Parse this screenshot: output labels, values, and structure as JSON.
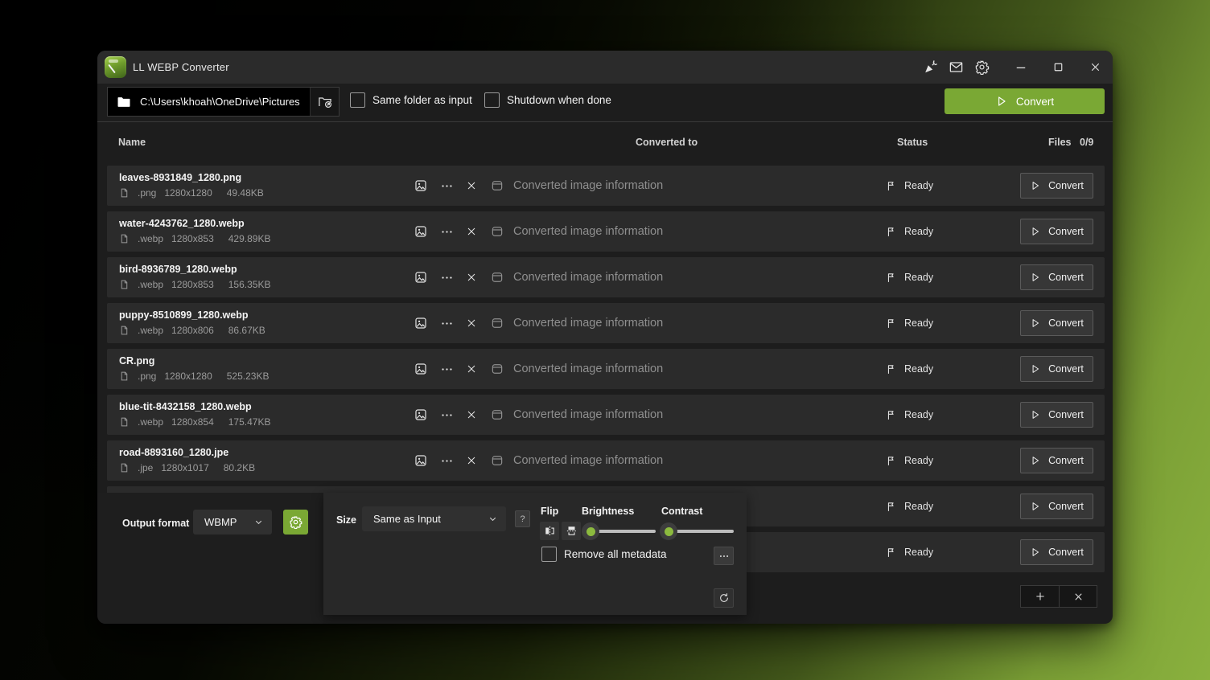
{
  "app": {
    "title": "LL WEBP Converter"
  },
  "toolbar": {
    "path": "C:\\Users\\khoah\\OneDrive\\Pictures",
    "same_folder_label": "Same folder as input",
    "shutdown_label": "Shutdown when done",
    "convert_label": "Convert"
  },
  "table": {
    "headers": {
      "name": "Name",
      "converted_to": "Converted to",
      "status": "Status",
      "files": "Files",
      "files_count": "0/9"
    },
    "rows": [
      {
        "name": "leaves-8931849_1280.png",
        "ext": ".png",
        "dims": "1280x1280",
        "size": "49.48KB",
        "converted": "Converted image information",
        "status": "Ready",
        "action": "Convert",
        "hidden": false
      },
      {
        "name": "water-4243762_1280.webp",
        "ext": ".webp",
        "dims": "1280x853",
        "size": "429.89KB",
        "converted": "Converted image information",
        "status": "Ready",
        "action": "Convert",
        "hidden": false
      },
      {
        "name": "bird-8936789_1280.webp",
        "ext": ".webp",
        "dims": "1280x853",
        "size": "156.35KB",
        "converted": "Converted image information",
        "status": "Ready",
        "action": "Convert",
        "hidden": false
      },
      {
        "name": "puppy-8510899_1280.webp",
        "ext": ".webp",
        "dims": "1280x806",
        "size": "86.67KB",
        "converted": "Converted image information",
        "status": "Ready",
        "action": "Convert",
        "hidden": false
      },
      {
        "name": "CR.png",
        "ext": ".png",
        "dims": "1280x1280",
        "size": "525.23KB",
        "converted": "Converted image information",
        "status": "Ready",
        "action": "Convert",
        "hidden": false
      },
      {
        "name": "blue-tit-8432158_1280.webp",
        "ext": ".webp",
        "dims": "1280x854",
        "size": "175.47KB",
        "converted": "Converted image information",
        "status": "Ready",
        "action": "Convert",
        "hidden": false
      },
      {
        "name": "road-8893160_1280.jpe",
        "ext": ".jpe",
        "dims": "1280x1017",
        "size": "80.2KB",
        "converted": "Converted image information",
        "status": "Ready",
        "action": "Convert",
        "hidden": false
      },
      {
        "name": "",
        "ext": "",
        "dims": "",
        "size": "",
        "converted": "",
        "status": "Ready",
        "action": "Convert",
        "hidden": true
      },
      {
        "name": "",
        "ext": "",
        "dims": "",
        "size": "",
        "converted": "",
        "status": "Ready",
        "action": "Convert",
        "hidden": true
      }
    ]
  },
  "settings": {
    "output_format_label": "Output format",
    "output_format_value": "WBMP",
    "size_label": "Size",
    "size_value": "Same as Input",
    "flip_label": "Flip",
    "brightness_label": "Brightness",
    "contrast_label": "Contrast",
    "remove_metadata_label": "Remove all metadata"
  },
  "icons": {
    "question": "?"
  },
  "colors": {
    "accent_green": "#7aa834",
    "window_bg": "#1d1d1d",
    "titlebar_bg": "#2b2b2b",
    "row_bg": "#2b2b2b",
    "desktop_green": "#8ab13e"
  }
}
